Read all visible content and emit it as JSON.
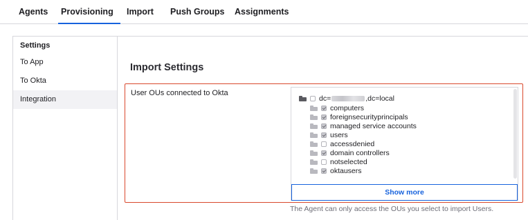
{
  "tabs": [
    {
      "label": "Agents"
    },
    {
      "label": "Provisioning",
      "active": true
    },
    {
      "label": "Import"
    },
    {
      "label": "Push Groups"
    },
    {
      "label": "Assignments"
    }
  ],
  "sidebar": {
    "heading": "Settings",
    "items": [
      {
        "label": "To App"
      },
      {
        "label": "To Okta"
      },
      {
        "label": "Integration",
        "active": true
      }
    ]
  },
  "main": {
    "heading": "Import Settings",
    "ou_label": "User OUs connected to Okta",
    "root": {
      "prefix": "dc=",
      "suffix": ",dc=local",
      "checked": false,
      "icon": "folder-open-icon"
    },
    "ous": [
      {
        "name": "computers",
        "checked": true
      },
      {
        "name": "foreignsecurityprincipals",
        "checked": true
      },
      {
        "name": "managed service accounts",
        "checked": true
      },
      {
        "name": "users",
        "checked": true
      },
      {
        "name": "accessdenied",
        "checked": false
      },
      {
        "name": "domain controllers",
        "checked": true
      },
      {
        "name": "notselected",
        "checked": false
      },
      {
        "name": "oktausers",
        "checked": true
      }
    ],
    "show_more_label": "Show more",
    "helper_text": "The Agent can only access the OUs you select to import Users."
  },
  "colors": {
    "accent": "#1662dd",
    "error_border": "#d9472b"
  }
}
